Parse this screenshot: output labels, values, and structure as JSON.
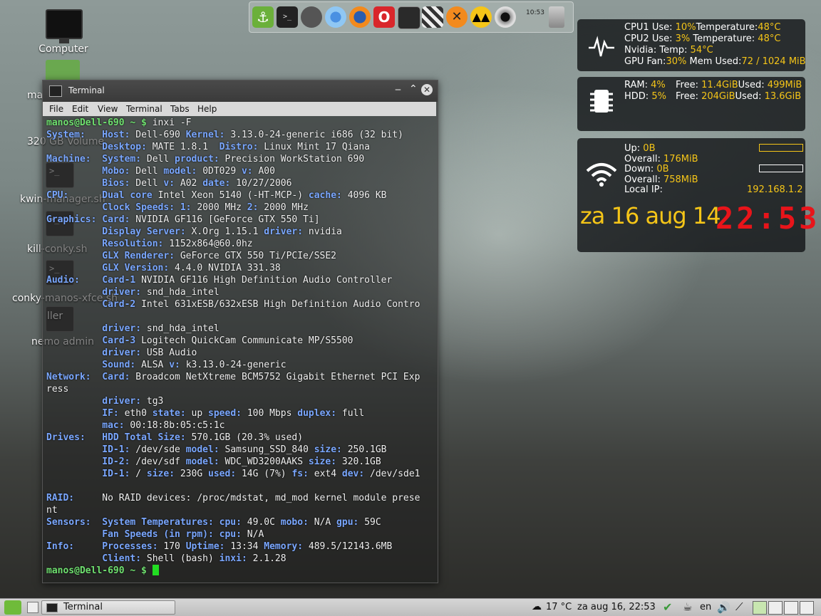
{
  "desktop": {
    "icons": [
      "Computer",
      "ma",
      "320 GB Volume",
      "kwin-manager.sh",
      "kill-conky.sh",
      "conky-manos-xfce.sh",
      "ller",
      "nemo admin"
    ]
  },
  "dock": {
    "clock": "10:53"
  },
  "conky": {
    "cpu1": {
      "label": "CPU1  Use:",
      "use": "10%",
      "temp_label": "Temperature:",
      "temp": "48°C"
    },
    "cpu2": {
      "label": "CPU2  Use:",
      "use": "3%",
      "temp_label": "Temperature:",
      "temp": "48°C"
    },
    "nvidia": {
      "label": "Nvidia:  Temp:",
      "temp": "54°C"
    },
    "gpu": {
      "fan_label": "GPU Fan:",
      "fan": "30%",
      "mem_label": "Mem Used:",
      "mem": "72 / 1024 MiB"
    },
    "ram": {
      "label": "RAM:",
      "pct": "4%",
      "free_label": "Free:",
      "free": "11.4GiB",
      "used_label": "Used:",
      "used": "499MiB"
    },
    "hdd": {
      "label": "HDD:",
      "pct": "5%",
      "free_label": "Free:",
      "free": "204GiB",
      "used_label": "Used:",
      "used": "13.6GiB"
    },
    "net": {
      "up_label": "Up:",
      "up": "0B",
      "overall_up_label": "Overall:",
      "overall_up": "176MiB",
      "down_label": "Down:",
      "down": "0B",
      "overall_down_label": "Overall:",
      "overall_down": "758MiB",
      "ip_label": "Local IP:",
      "ip": "192.168.1.2"
    },
    "date": "za 16 aug 14",
    "time": "22:53"
  },
  "terminal": {
    "title": "Terminal",
    "menu": [
      "File",
      "Edit",
      "View",
      "Terminal",
      "Tabs",
      "Help"
    ],
    "prompt": "manos@Dell-690 ~ $",
    "command": "inxi -F",
    "lines": [
      [
        [
          "b",
          "System:   "
        ],
        [
          "b",
          "Host: "
        ],
        [
          "w",
          "Dell-690 "
        ],
        [
          "b",
          "Kernel: "
        ],
        [
          "w",
          "3.13.0-24-generic i686 (32 bit)"
        ]
      ],
      [
        [
          "w",
          "          "
        ],
        [
          "b",
          "Desktop: "
        ],
        [
          "w",
          "MATE 1.8.1  "
        ],
        [
          "b",
          "Distro: "
        ],
        [
          "w",
          "Linux Mint 17 Qiana"
        ]
      ],
      [
        [
          "b",
          "Machine:  "
        ],
        [
          "b",
          "System: "
        ],
        [
          "w",
          "Dell "
        ],
        [
          "b",
          "product: "
        ],
        [
          "w",
          "Precision WorkStation 690"
        ]
      ],
      [
        [
          "w",
          "          "
        ],
        [
          "b",
          "Mobo: "
        ],
        [
          "w",
          "Dell "
        ],
        [
          "b",
          "model: "
        ],
        [
          "w",
          "0DT029 "
        ],
        [
          "b",
          "v: "
        ],
        [
          "w",
          "A00"
        ]
      ],
      [
        [
          "w",
          "          "
        ],
        [
          "b",
          "Bios: "
        ],
        [
          "w",
          "Dell "
        ],
        [
          "b",
          "v: "
        ],
        [
          "w",
          "A02 "
        ],
        [
          "b",
          "date: "
        ],
        [
          "w",
          "10/27/2006"
        ]
      ],
      [
        [
          "b",
          "CPU:      "
        ],
        [
          "b",
          "Dual core "
        ],
        [
          "w",
          "Intel Xeon 5140 (-HT-MCP-) "
        ],
        [
          "b",
          "cache: "
        ],
        [
          "w",
          "4096 KB"
        ]
      ],
      [
        [
          "w",
          "          "
        ],
        [
          "b",
          "Clock Speeds: "
        ],
        [
          "b",
          "1: "
        ],
        [
          "w",
          "2000 MHz "
        ],
        [
          "b",
          "2: "
        ],
        [
          "w",
          "2000 MHz"
        ]
      ],
      [
        [
          "b",
          "Graphics: "
        ],
        [
          "b",
          "Card: "
        ],
        [
          "w",
          "NVIDIA GF116 [GeForce GTX 550 Ti]"
        ]
      ],
      [
        [
          "w",
          "          "
        ],
        [
          "b",
          "Display Server: "
        ],
        [
          "w",
          "X.Org 1.15.1 "
        ],
        [
          "b",
          "driver: "
        ],
        [
          "w",
          "nvidia"
        ]
      ],
      [
        [
          "w",
          "          "
        ],
        [
          "b",
          "Resolution: "
        ],
        [
          "w",
          "1152x864@60.0hz"
        ]
      ],
      [
        [
          "w",
          "          "
        ],
        [
          "b",
          "GLX Renderer: "
        ],
        [
          "w",
          "GeForce GTX 550 Ti/PCIe/SSE2"
        ]
      ],
      [
        [
          "w",
          "          "
        ],
        [
          "b",
          "GLX Version: "
        ],
        [
          "w",
          "4.4.0 NVIDIA 331.38"
        ]
      ],
      [
        [
          "b",
          "Audio:    "
        ],
        [
          "b",
          "Card-1 "
        ],
        [
          "w",
          "NVIDIA GF116 High Definition Audio Controller"
        ]
      ],
      [
        [
          "w",
          "          "
        ],
        [
          "b",
          "driver: "
        ],
        [
          "w",
          "snd_hda_intel"
        ]
      ],
      [
        [
          "w",
          "          "
        ],
        [
          "b",
          "Card-2 "
        ],
        [
          "w",
          "Intel 631xESB/632xESB High Definition Audio Contro"
        ]
      ],
      [
        [
          "w",
          ""
        ]
      ],
      [
        [
          "w",
          "          "
        ],
        [
          "b",
          "driver: "
        ],
        [
          "w",
          "snd_hda_intel"
        ]
      ],
      [
        [
          "w",
          "          "
        ],
        [
          "b",
          "Card-3 "
        ],
        [
          "w",
          "Logitech QuickCam Communicate MP/S5500"
        ]
      ],
      [
        [
          "w",
          "          "
        ],
        [
          "b",
          "driver: "
        ],
        [
          "w",
          "USB Audio"
        ]
      ],
      [
        [
          "w",
          "          "
        ],
        [
          "b",
          "Sound: "
        ],
        [
          "w",
          "ALSA "
        ],
        [
          "b",
          "v: "
        ],
        [
          "w",
          "k3.13.0-24-generic"
        ]
      ],
      [
        [
          "b",
          "Network:  "
        ],
        [
          "b",
          "Card: "
        ],
        [
          "w",
          "Broadcom NetXtreme BCM5752 Gigabit Ethernet PCI Exp"
        ]
      ],
      [
        [
          "w",
          "ress"
        ]
      ],
      [
        [
          "w",
          "          "
        ],
        [
          "b",
          "driver: "
        ],
        [
          "w",
          "tg3"
        ]
      ],
      [
        [
          "w",
          "          "
        ],
        [
          "b",
          "IF: "
        ],
        [
          "w",
          "eth0 "
        ],
        [
          "b",
          "state: "
        ],
        [
          "w",
          "up "
        ],
        [
          "b",
          "speed: "
        ],
        [
          "w",
          "100 Mbps "
        ],
        [
          "b",
          "duplex: "
        ],
        [
          "w",
          "full"
        ]
      ],
      [
        [
          "w",
          "          "
        ],
        [
          "b",
          "mac: "
        ],
        [
          "w",
          "00:18:8b:05:c5:1c"
        ]
      ],
      [
        [
          "b",
          "Drives:   "
        ],
        [
          "b",
          "HDD Total Size: "
        ],
        [
          "w",
          "570.1GB (20.3% used)"
        ]
      ],
      [
        [
          "w",
          "          "
        ],
        [
          "b",
          "ID-1: "
        ],
        [
          "w",
          "/dev/sde "
        ],
        [
          "b",
          "model: "
        ],
        [
          "w",
          "Samsung_SSD_840 "
        ],
        [
          "b",
          "size: "
        ],
        [
          "w",
          "250.1GB"
        ]
      ],
      [
        [
          "w",
          "          "
        ],
        [
          "b",
          "ID-2: "
        ],
        [
          "w",
          "/dev/sdf "
        ],
        [
          "b",
          "model: "
        ],
        [
          "w",
          "WDC_WD3200AAKS "
        ],
        [
          "b",
          "size: "
        ],
        [
          "w",
          "320.1GB"
        ]
      ],
      [
        [
          "w",
          "          "
        ],
        [
          "b",
          "ID-1: "
        ],
        [
          "w",
          "/ "
        ],
        [
          "b",
          "size: "
        ],
        [
          "w",
          "230G "
        ],
        [
          "b",
          "used: "
        ],
        [
          "w",
          "14G (7%) "
        ],
        [
          "b",
          "fs: "
        ],
        [
          "w",
          "ext4 "
        ],
        [
          "b",
          "dev: "
        ],
        [
          "w",
          "/dev/sde1"
        ]
      ],
      [
        [
          "w",
          ""
        ]
      ],
      [
        [
          "b",
          "RAID:     "
        ],
        [
          "w",
          "No RAID devices: /proc/mdstat, md_mod kernel module prese"
        ]
      ],
      [
        [
          "w",
          "nt"
        ]
      ],
      [
        [
          "b",
          "Sensors:  "
        ],
        [
          "b",
          "System Temperatures: "
        ],
        [
          "b",
          "cpu: "
        ],
        [
          "w",
          "49.0C "
        ],
        [
          "b",
          "mobo: "
        ],
        [
          "w",
          "N/A "
        ],
        [
          "b",
          "gpu: "
        ],
        [
          "w",
          "59C"
        ]
      ],
      [
        [
          "w",
          "          "
        ],
        [
          "b",
          "Fan Speeds (in rpm): "
        ],
        [
          "b",
          "cpu: "
        ],
        [
          "w",
          "N/A"
        ]
      ],
      [
        [
          "b",
          "Info:     "
        ],
        [
          "b",
          "Processes: "
        ],
        [
          "w",
          "170 "
        ],
        [
          "b",
          "Uptime: "
        ],
        [
          "w",
          "13:34 "
        ],
        [
          "b",
          "Memory: "
        ],
        [
          "w",
          "489.5/12143.6MB"
        ]
      ],
      [
        [
          "w",
          "          "
        ],
        [
          "b",
          "Client: "
        ],
        [
          "w",
          "Shell (bash) "
        ],
        [
          "b",
          "inxi: "
        ],
        [
          "w",
          "2.1.28"
        ]
      ]
    ]
  },
  "panel": {
    "task": "Terminal",
    "weather": "17 °C",
    "clock": "za aug 16, 22:53",
    "keyboard": "en"
  }
}
